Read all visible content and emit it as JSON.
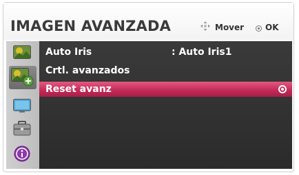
{
  "header": {
    "title": "IMAGEN AVANZADA",
    "hint_move": "Mover",
    "hint_ok": "OK"
  },
  "sidebar": {
    "items": [
      {
        "icon": "picture-icon",
        "active": false
      },
      {
        "icon": "picture-advanced-icon",
        "active": true
      },
      {
        "icon": "screen-icon",
        "active": false
      },
      {
        "icon": "toolbox-icon",
        "active": false
      },
      {
        "icon": "info-icon",
        "active": false
      }
    ]
  },
  "menu": {
    "rows": [
      {
        "label": "Auto Iris",
        "value": ": Auto Iris1",
        "selected": false
      },
      {
        "label": "Crtl. avanzados",
        "value": "",
        "selected": false
      },
      {
        "label": "Reset avanz",
        "value": "",
        "selected": true
      }
    ]
  },
  "colors": {
    "highlight": "#c42c59",
    "panel": "#333333",
    "sidebar": "#c8c8c8"
  }
}
